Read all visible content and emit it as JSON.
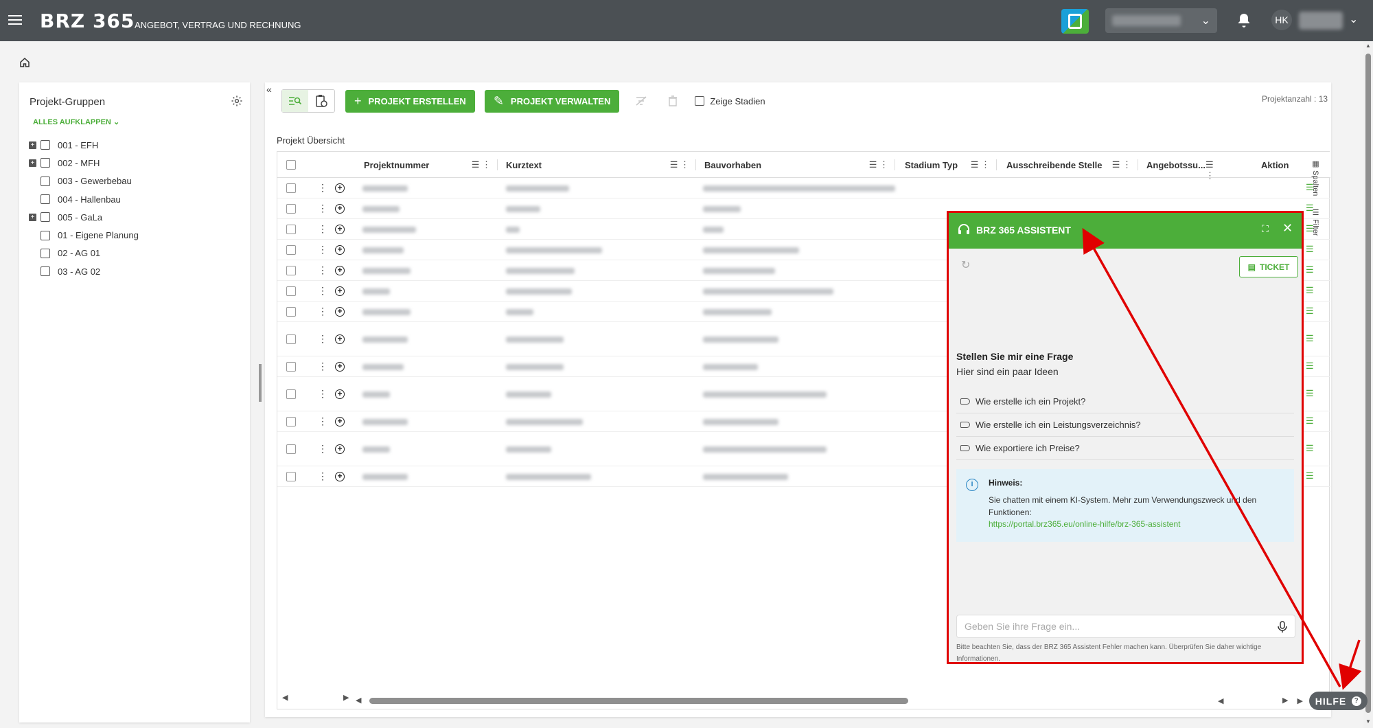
{
  "header": {
    "logo_text": "BRZ 365",
    "subtitle": "ANGEBOT, VERTRAG UND RECHNUNG",
    "user_initials": "HK"
  },
  "left_panel": {
    "title": "Projekt-Gruppen",
    "expand_all_label": "ALLES AUFKLAPPEN",
    "groups": [
      {
        "label": "001 - EFH",
        "expandable": true,
        "indent": 0
      },
      {
        "label": "002 - MFH",
        "expandable": true,
        "indent": 0
      },
      {
        "label": "003 - Gewerbebau",
        "expandable": false,
        "indent": 0
      },
      {
        "label": "004 - Hallenbau",
        "expandable": false,
        "indent": 0
      },
      {
        "label": "005 - GaLa",
        "expandable": true,
        "indent": 0
      },
      {
        "label": "01 - Eigene Planung",
        "expandable": false,
        "indent": 0
      },
      {
        "label": "02 - AG 01",
        "expandable": false,
        "indent": 0
      },
      {
        "label": "03 - AG 02",
        "expandable": false,
        "indent": 0
      }
    ]
  },
  "toolbar": {
    "create_project_label": "PROJEKT ERSTELLEN",
    "manage_project_label": "PROJEKT VERWALTEN",
    "show_stages_label": "Zeige Stadien",
    "project_count_label": "Projektanzahl : 13"
  },
  "grid": {
    "title": "Projekt Übersicht",
    "columns": [
      {
        "key": "projektnummer",
        "label": "Projektnummer"
      },
      {
        "key": "kurztext",
        "label": "Kurztext"
      },
      {
        "key": "bauvorhaben",
        "label": "Bauvorhaben"
      },
      {
        "key": "stadium_typ",
        "label": "Stadium Typ"
      },
      {
        "key": "ausschreibende_stelle",
        "label": "Ausschreibende Stelle"
      },
      {
        "key": "angebotssumme",
        "label": "Angebotssu..."
      },
      {
        "key": "aktion",
        "label": "Aktion"
      }
    ],
    "row_count": 13,
    "side_tabs": [
      "Spalten",
      "Filter"
    ]
  },
  "assistant": {
    "title": "BRZ 365 ASSISTENT",
    "ticket_label": "TICKET",
    "heading": "Stellen Sie mir eine Frage",
    "subheading": "Hier sind ein paar Ideen",
    "suggestions": [
      "Wie erstelle ich ein Projekt?",
      "Wie erstelle ich ein Leistungsverzeichnis?",
      "Wie exportiere ich Preise?"
    ],
    "hint_title": "Hinweis:",
    "hint_text": "Sie chatten mit einem KI-System. Mehr zum Verwendungszweck und den Funktionen:",
    "hint_link": "https://portal.brz365.eu/online-hilfe/brz-365-assistent",
    "input_placeholder": "Geben Sie ihre Frage ein...",
    "disclaimer": "Bitte beachten Sie, dass der BRZ 365 Assistent Fehler machen kann. Überprüfen Sie daher wichtige Informationen."
  },
  "help_button": {
    "label": "HILFE"
  },
  "colors": {
    "topbar": "#4b5054",
    "accent_green": "#4cae3a",
    "annotation_red": "#e00000",
    "hint_bg": "#e3f2f9"
  }
}
